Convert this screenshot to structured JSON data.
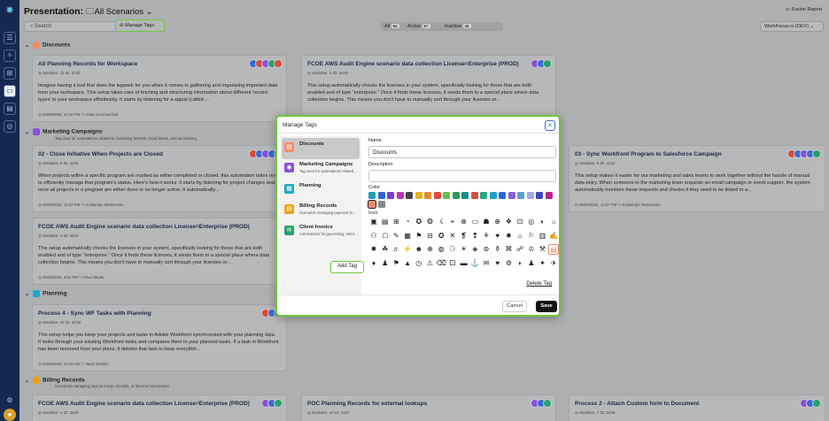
{
  "page": {
    "title": "Presentation:",
    "subtitle": "All Scenarios",
    "fusion_label": "Fusion Report",
    "search_placeholder": "Search",
    "manage_tags": "Manage Tags",
    "filters": [
      {
        "label": "All",
        "count": "94"
      },
      {
        "label": "Active",
        "count": "87"
      },
      {
        "label": "Inactive",
        "count": "36"
      }
    ],
    "workspace": "WorkFocus.io (DEV)"
  },
  "sections": {
    "discounts": {
      "title": "Discounts"
    },
    "marketing": {
      "title": "Marketing Campaigns",
      "sub": "Tag used for automations related to marketing formats, email blasts, and ad tracking"
    },
    "planning": {
      "title": "Planning"
    },
    "billing": {
      "title": "Billing Records",
      "sub": "Scenarios managing payment logs, receipts, or financial summaries"
    }
  },
  "cards": {
    "c1": {
      "title": "All Planning Records for Workspace",
      "meta": "◎ Modules: 11   ID: 3742",
      "desc": "Imagine having a tool that does the legwork for you when it comes to gathering and organizing important data from your workspace. This setup takes care of fetching and structuring information about different 'record types' in your workspace effortlessly. It starts by listening for a signal (called ...",
      "foot": "◷ 03/09/2025, 12:46 PM   ⚇ Anton Kozmenchuk"
    },
    "c2": {
      "title": "FCOE AWS Audit Engine scenario data collection License=Enterprise (PROD)",
      "meta": "◎ Modules: 4   ID: 3419",
      "desc": "This setup automatically checks the licenses in your system, specifically looking for those that are both enabled and of type \"enterprise.\" Once it finds these licenses, it sends them to a special place where data collection begins. This means you don't have to manually sort through your licenses or...",
      "foot": ""
    },
    "c3": {
      "title": "02 - Close Initiative When Projects are Closed",
      "meta": "◎ Modules: 6   ID: 4243",
      "desc": "When projects within a specific program are marked as either completed or closed, this automation takes over to efficiently manage that program's status. Here's how it works: it starts by listening for project changes and, once all projects in a program are either done or no longer active, it automatically...",
      "foot": "◷ 06/09/2025, 12:34 PM   ⚇ Kostiantyn Nesterenko"
    },
    "c4": {
      "title": "03 - Sync Workfront Program to Salesforce Campaign",
      "meta": "◎ Modules: 9   ID: 4242",
      "desc": "This setup makes it easier for our marketing and sales teams to work together without the hassle of manual data entry. When someone in the marketing team requests an email campaign or event support, the system automatically monitors these requests and checks if they need to be linked to a...",
      "foot": "◷ 06/23/2025, 12:57 PM   ⚇ Kostiantyn Nesterenko"
    },
    "c5": {
      "title": "FCOE AWS Audit Engine scenario data collection License=Enterprise (PROD)",
      "meta": "◎ Modules: 4   ID: 3419",
      "desc": "This setup automatically checks the licenses in your system, specifically looking for those that are both enabled and of type \"enterprise.\" Once it finds these licenses, it sends them to a special place where data collection begins. This means you don't have to manually sort through your licenses or...",
      "foot": "◷ 05/23/2025, 4:52 PM   ⚇ Pavo Shpak"
    },
    "c6": {
      "title": "Process 4 - Sync WF Tasks with Planning",
      "meta": "◎ Modules: 47   ID: 3748",
      "desc": "This setup helps you keep your projects and tasks in Adobe Workfront synchronized with your planning data. It looks through your existing Workfront tasks and compares them to your planned tasks. If a task in Workfront has been removed from your plans, it deletes that task to keep everythin...",
      "foot": "◷ 03/09/2025, 10:46 AM   ⚇ Vasyl Veselyn"
    },
    "c7": {
      "title": "FCOE AWS Audit Engine scenario data collection License=Enterprise (PROD)",
      "meta": "◎ Modules: 4   ID: 3419",
      "desc": "",
      "foot": ""
    },
    "c8": {
      "title": "POC Planning Records for external lookups",
      "meta": "◎ Modules: 10   ID: 3427",
      "desc": "",
      "foot": ""
    },
    "c9": {
      "title": "Process 2 - Attach Custom form to Document",
      "meta": "◎ Modules: 7   ID: 3448",
      "desc": "",
      "foot": ""
    }
  },
  "modal": {
    "title": "Manage Tags",
    "close": "×",
    "tags": [
      {
        "name": "Discounts",
        "desc": "",
        "color": "#f28c63",
        "icon": "▤"
      },
      {
        "name": "Marketing Campaigns",
        "desc": "Tag used for automations related to marketing",
        "color": "#8a4fd8",
        "icon": "◉"
      },
      {
        "name": "Planning",
        "desc": "",
        "color": "#1ea7c8",
        "icon": "▦"
      },
      {
        "name": "Billing Records",
        "desc": "Scenarios managing payment logs, receipts",
        "color": "#e8a21a",
        "icon": "▤"
      },
      {
        "name": "Client Invoice",
        "desc": "Automations for generating, sending invoices",
        "color": "#26a269",
        "icon": "✉"
      }
    ],
    "add_tag": "Add Tag",
    "name_label": "Name",
    "name_value": "Discounts",
    "description_label": "Description",
    "description_value": "",
    "color_label": "Color",
    "icon_label": "Icon",
    "delete_tag": "Delete Tag",
    "cancel": "Cancel",
    "save": "Save",
    "colors": [
      "#1a9fb5",
      "#2b64d6",
      "#7a3fd0",
      "#c233b8",
      "#444444",
      "#e2b21c",
      "#e58a32",
      "#e04a3c",
      "#6fc04a",
      "#2c9c58",
      "#1b8c8c",
      "#d64d40",
      "#2aa58a",
      "#22a0c8",
      "#2f6cd4",
      "#8a5fd8",
      "#5f9bd8",
      "#a7a7f0",
      "#3c48b8",
      "#b8248a",
      "#f08e72",
      "#888888"
    ],
    "selected_color": 20,
    "icons": [
      "▣",
      "▤",
      "⊞",
      "◔",
      "✪",
      "❂",
      "☇",
      "⌖",
      "⊗",
      "▭",
      "☗",
      "⊕",
      "❖",
      "⊡",
      "◎",
      "◐",
      "☼",
      "⚇",
      "☖",
      "✎",
      "▦",
      "⚑",
      "⊟",
      "✪",
      "✕",
      "❡",
      "❢",
      "⚘",
      "♥",
      "✹",
      "⌂",
      "⚐",
      "▥",
      "✍",
      "✸",
      "☘",
      "♬",
      "⚡",
      "☻",
      "⊕",
      "◍",
      "⚆",
      "☀",
      "◈",
      "⊚",
      "⚱",
      "⌘",
      "☍",
      "♔",
      "⚒",
      "▤",
      "♦",
      "♟",
      "⚑",
      "▲",
      "◷",
      "⚠",
      "⌫",
      "⚀",
      "▬",
      "⚓",
      "✉",
      "♥",
      "⚙",
      "◗",
      "♟",
      "✦",
      "✈"
    ],
    "selected_icon": 50
  },
  "sidebar_icons": [
    "logo-icon",
    "menu-icon",
    "rocket-icon",
    "grid-icon",
    "presentation-icon",
    "message-icon",
    "target-icon",
    "settings-icon",
    "user-icon"
  ]
}
